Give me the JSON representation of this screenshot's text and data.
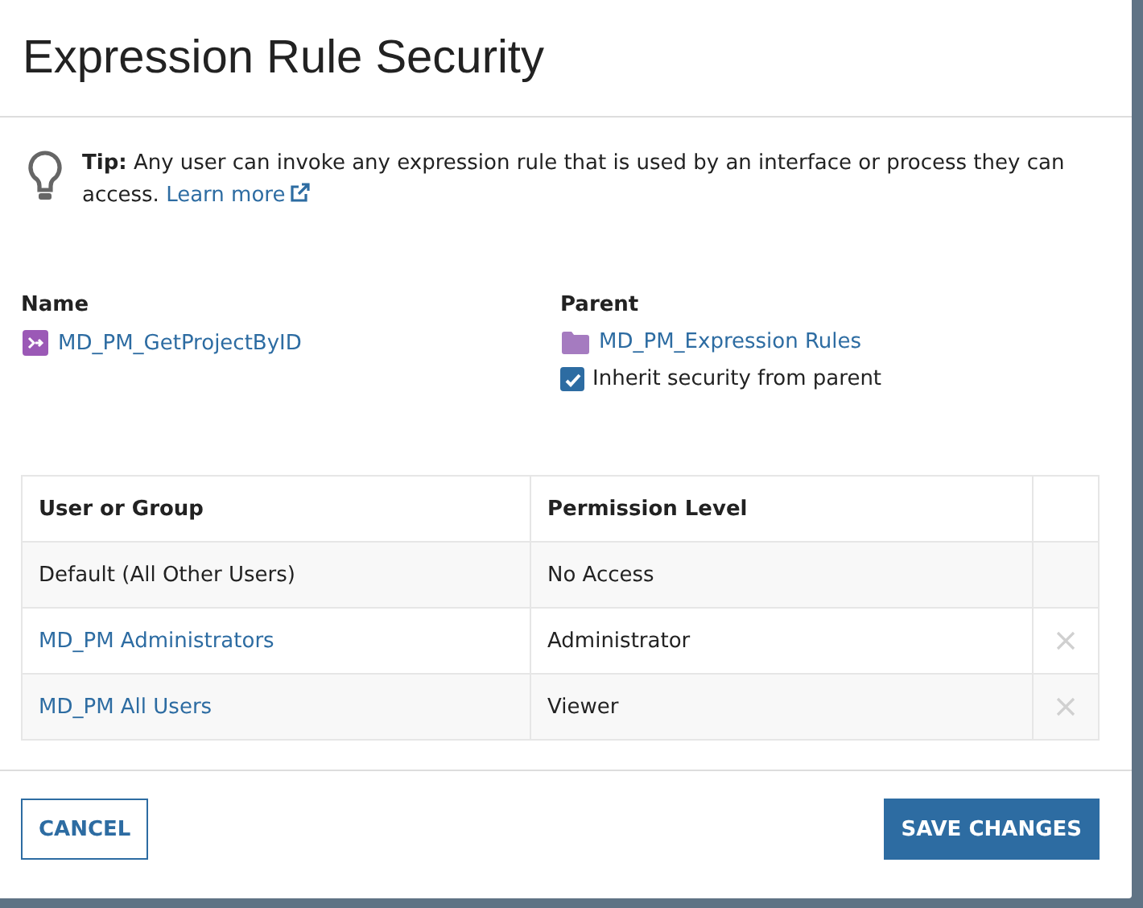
{
  "dialog": {
    "title": "Expression Rule Security"
  },
  "tip": {
    "text": "**Tip:** Any user can invoke any expression rule that is used by an interface or process they can access.",
    "link": "Learn more"
  },
  "name": {
    "label": "Name",
    "value": "MD_PM_GetProjectByID"
  },
  "parent": {
    "label": "Parent",
    "value": "MD_PM_Expression Rules",
    "inherit_label": "Inherit security from parent",
    "checked": true
  },
  "table": {
    "columns": [
      "User or Group",
      "Permission Level"
    ],
    "rows": [
      {
        "user": "Default (All Other Users)",
        "permission": "No Access",
        "link": false,
        "removable": false
      },
      {
        "user": "MD_PM Administrators",
        "permission": "Administrator",
        "link": true,
        "removable": true
      },
      {
        "user": "MD_PM All Users",
        "permission": "Viewer",
        "link": true,
        "removable": true
      }
    ]
  },
  "buttons": {
    "cancel": "CANCEL",
    "save": "SAVE CHANGES"
  }
}
